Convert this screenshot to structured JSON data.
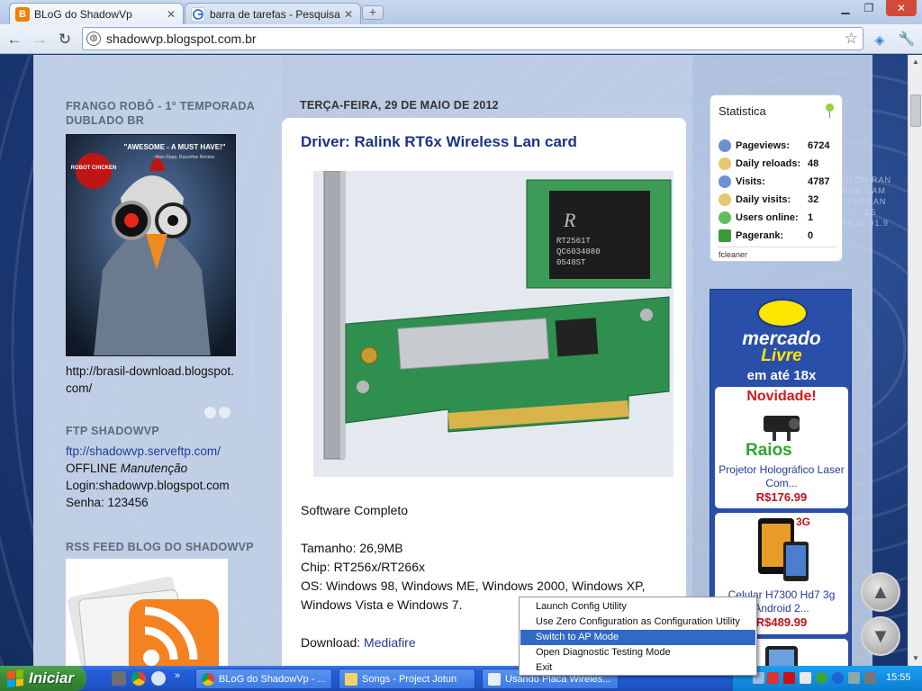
{
  "browser": {
    "tabs": [
      {
        "title": "BLoG do ShadowVp",
        "active": true
      },
      {
        "title": "barra de tarefas - Pesquisa Goo",
        "active": false
      }
    ],
    "url": "shadowvp.blogspot.com.br"
  },
  "sidebar": {
    "section1_title": "FRANGO ROBÔ - 1° TEMPORADA DUBLADO BR",
    "poster_quote": "\"AWESOME - A MUST HAVE!\"",
    "poster_quote_source": "~Alan Rapp, Razorfine Review",
    "poster_badge": "ROBOT CHICKEN",
    "poster_link": "http://brasil-download.blogspot.com/",
    "section2_title": "FTP SHADOWVP",
    "ftp_link": "ftp://shadowvp.serveftp.com/",
    "ftp_status_prefix": "OFFLINE",
    "ftp_status_suffix": "Manutenção",
    "ftp_login": "Login:shadowvp.blogspot.com",
    "ftp_password": "Senha: 123456",
    "section3_title": "RSS FEED BLOG DO SHADOWVP"
  },
  "post": {
    "date": "TERÇA-FEIRA, 29 DE MAIO DE 2012",
    "title": "Driver: Ralink RT6x Wireless Lan card",
    "chip_text": [
      "RT2561T",
      "QC6034080",
      "0548ST"
    ],
    "lines": {
      "software": "Software Completo",
      "size": "Tamanho: 26,9MB",
      "chip": "Chip: RT256x/RT266x",
      "os": "OS: Windows 98, Windows ME, Windows 2000, Windows XP, Windows Vista e Windows 7.",
      "download_label": "Download: ",
      "download_link": "Mediafire"
    }
  },
  "stats": {
    "title": "Statistica",
    "rows": [
      {
        "label": "Pageviews:",
        "value": "6724",
        "icon_color": "#6d8fd6"
      },
      {
        "label": "Daily reloads:",
        "value": "48",
        "icon_color": "#e7c66e"
      },
      {
        "label": "Visits:",
        "value": "4787",
        "icon_color": "#6d8fd6"
      },
      {
        "label": "Daily visits:",
        "value": "32",
        "icon_color": "#e7c66e"
      },
      {
        "label": "Users online:",
        "value": "1",
        "icon_color": "#5ebd5e"
      },
      {
        "label": "Pagerank:",
        "value": "0",
        "icon_color": "#3a9a3a"
      }
    ],
    "footer": "fcleaner"
  },
  "ad": {
    "brand_line1": "mercado",
    "brand_line2": "Livre",
    "subtitle": "em até 18x",
    "items": [
      {
        "badge": "Novidade!",
        "badge2": "Raios",
        "name": "Projetor Holográfico Laser Com...",
        "price": "R$176.99"
      },
      {
        "badge": "3G",
        "name": "Celular H7300 Hd7 3g Android 2...",
        "price": "R$489.99"
      }
    ]
  },
  "context_menu": {
    "items": [
      {
        "label": "Launch Config Utility",
        "highlighted": false
      },
      {
        "label": "Use Zero Configuration as Configuration Utility",
        "highlighted": false
      },
      {
        "label": "Switch to AP Mode",
        "highlighted": true
      },
      {
        "label": "Open Diagnostic Testing Mode",
        "highlighted": false
      },
      {
        "label": "Exit",
        "highlighted": false
      }
    ]
  },
  "taskbar": {
    "start_label": "Iniciar",
    "tasks": [
      {
        "label": "BLoG do ShadowVp - ...",
        "active": false
      },
      {
        "label": "Songs - Project Jotun",
        "active": false
      },
      {
        "label": "Usando Placa Wireles...",
        "active": false
      }
    ],
    "clock": "15:55"
  },
  "colors": {
    "link": "#1f3c9a",
    "post_title": "#1b3386",
    "price": "#c0111a",
    "menu_highlight": "#3169c6"
  }
}
